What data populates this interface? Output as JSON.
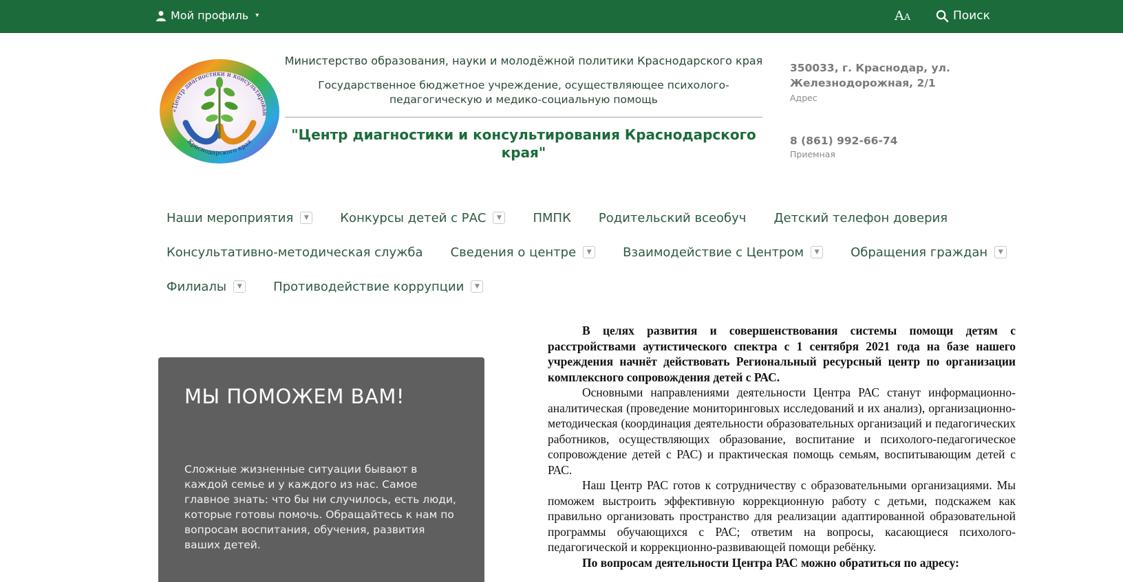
{
  "topbar": {
    "profile_label": "Мой профиль",
    "font_size_big": "A",
    "font_size_small": "A",
    "search_label": "Поиск",
    "bg_color": "#1c6b3a"
  },
  "header": {
    "ministry": "Министерство образования, науки и молодёжной политики Краснодарского края",
    "institution": "Государственное бюджетное учреждение, осуществляющее психолого-педагогическую и медико-социальную помощь",
    "center_name": "\"Центр диагностики и консультирования Краснодарского края\"",
    "logo_text_top": "ГБУ «Центр диагностики и консультирования»",
    "logo_text_bottom": "Краснодарского края"
  },
  "contacts": {
    "address": "350033, г. Краснодар, ул. Железнодорожная, 2/1",
    "address_caption": "Адрес",
    "phone": "8 (861) 992-66-74",
    "phone_caption": "Приемная"
  },
  "nav": {
    "row1": [
      {
        "label": "Наши мероприятия",
        "dropdown": true
      },
      {
        "label": "Конкурсы детей с РАС",
        "dropdown": true
      },
      {
        "label": "ПМПК",
        "dropdown": false
      },
      {
        "label": "Родительский всеобуч",
        "dropdown": false
      },
      {
        "label": "Детский телефон доверия",
        "dropdown": false
      }
    ],
    "row2": [
      {
        "label": "Консультативно-методическая служба",
        "dropdown": false
      },
      {
        "label": "Сведения о центре",
        "dropdown": true
      },
      {
        "label": "Взаимодействие с Центром",
        "dropdown": true
      },
      {
        "label": "Обращения граждан",
        "dropdown": true
      }
    ],
    "row3": [
      {
        "label": "Филиалы",
        "dropdown": true
      },
      {
        "label": "Противодействие коррупции",
        "dropdown": true
      }
    ]
  },
  "card": {
    "title": "МЫ ПОМОЖЕМ ВАМ!",
    "text": "Сложные жизненные ситуации бывают в каждой семье и у каждого из нас. Самое главное знать: что бы ни случилось, есть люди, которые готовы помочь. Обращайтесь к нам по вопросам воспитания, обучения, развития ваших детей."
  },
  "doc": {
    "p1": "В целях развития и совершенствования системы помощи детям с расстройствами аутистического спектра с 1 сентября 2021 года на базе нашего учреждения начнёт действовать Региональный ресурсный центр по организации комплексного сопровождения детей с РАС.",
    "p2": "Основными направлениями деятельности Центра РАС станут информационно-аналитическая (проведение мониторинговых исследований и их анализ), организационно-методическая (координация деятельности образовательных организаций и педагогических работников, осуществляющих образование, воспитание и психолого-педагогическое сопровождение детей с РАС) и практическая помощь семьям, воспитывающим детей с РАС.",
    "p3": "Наш Центр РАС готов к сотрудничеству с образовательными организациями. Мы поможем выстроить эффективную коррекционную работу с детьми, подскажем как правильно организовать пространство для реализации адаптированной образовательной программы обучающихся с РАС; ответим на вопросы, касающиеся психолого-педагогической и коррекционно-развивающей помощи ребёнку.",
    "p4": "По вопросам деятельности Центра РАС можно обратиться по адресу:"
  }
}
